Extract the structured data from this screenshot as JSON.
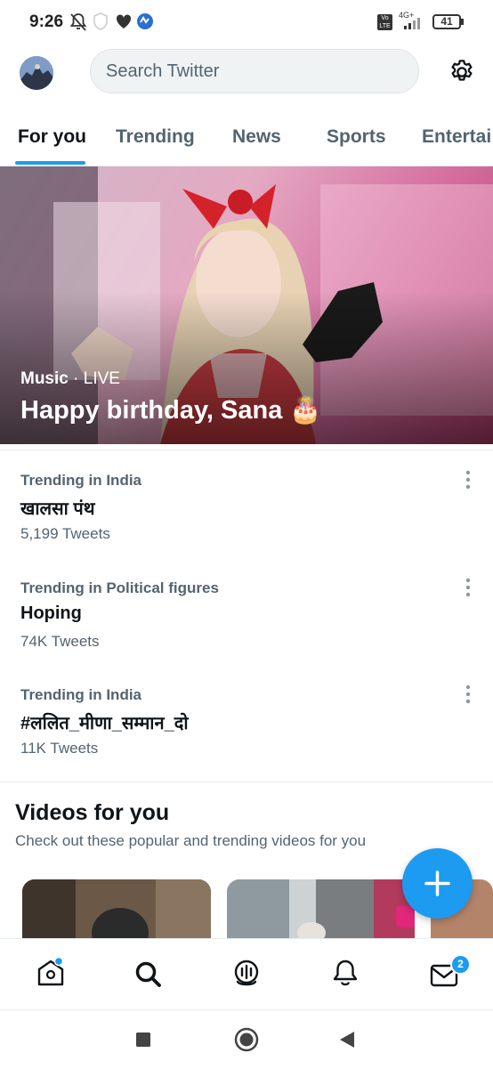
{
  "status_bar": {
    "time": "9:26",
    "network": "4G+",
    "volte": "Vo LTE",
    "battery": "41"
  },
  "search": {
    "placeholder": "Search Twitter"
  },
  "tabs": [
    {
      "label": "For you",
      "active": true
    },
    {
      "label": "Trending",
      "active": false
    },
    {
      "label": "News",
      "active": false
    },
    {
      "label": "Sports",
      "active": false
    },
    {
      "label": "Entertai",
      "active": false
    }
  ],
  "hero": {
    "category": "Music",
    "separator": " · ",
    "live": "LIVE",
    "title": "Happy birthday, Sana 🎂"
  },
  "trends": [
    {
      "context": "Trending in India",
      "name": "खालसा पंथ",
      "count": "5,199 Tweets"
    },
    {
      "context": "Trending in Political figures",
      "name": "Hoping",
      "count": "74K Tweets"
    },
    {
      "context": "Trending in India",
      "name": "#ललित_मीणा_सम्मान_दो",
      "count": "11K Tweets"
    }
  ],
  "videos": {
    "title": "Videos for you",
    "subtitle": "Check out these popular and trending videos for you"
  },
  "nav": {
    "messages_badge": "2"
  },
  "colors": {
    "accent": "#1d9bf0",
    "text": "#0f1419",
    "secondary": "#536471"
  }
}
